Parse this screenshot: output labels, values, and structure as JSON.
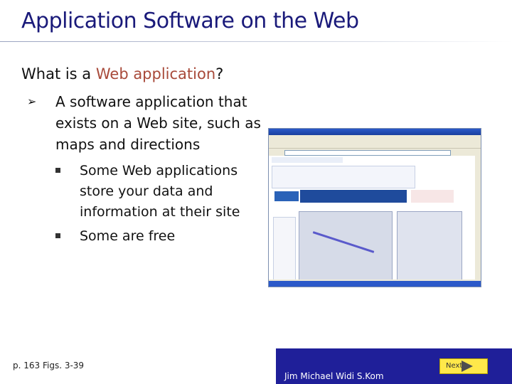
{
  "slide": {
    "title": "Application Software on the Web",
    "question": {
      "prefix": "What is a ",
      "highlight": "Web application",
      "suffix": "?"
    },
    "bullet_main": "A software application that exists on a Web site, such as maps and directions",
    "sub_bullets": [
      "Some Web applications store your data and information at their site",
      "Some are free"
    ]
  },
  "footer": {
    "reference": "p. 163 Figs. 3-39",
    "author": "Jim Michael Widi S.Kom",
    "next_label": "Next"
  },
  "colors": {
    "title": "#1a1a7a",
    "highlight": "#a84a3a",
    "footer_bar": "#1f1f99",
    "next_button": "#ffe84a"
  },
  "icons": {
    "bullet_main": "arrow-bullet-icon",
    "sub_bullet": "square-bullet-icon",
    "next": "play-triangle-icon"
  }
}
